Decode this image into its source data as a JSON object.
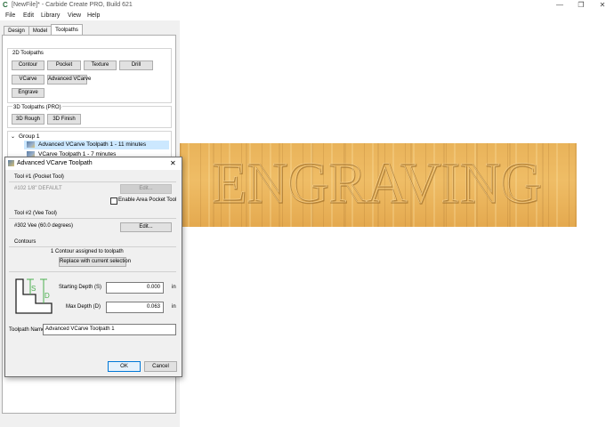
{
  "window": {
    "title": "[NewFile]* - Carbide Create PRO, Build 621",
    "controls": [
      "—",
      "❐",
      "✕"
    ]
  },
  "menu": [
    "File",
    "Edit",
    "Library",
    "View",
    "Help"
  ],
  "tabs": [
    "Design",
    "Model",
    "Toolpaths"
  ],
  "toolpaths_2d": {
    "title": "2D Toolpaths",
    "buttons": [
      "Contour",
      "Pocket",
      "Texture",
      "Drill",
      "VCarve",
      "Advanced VCarve",
      "Engrave"
    ]
  },
  "toolpaths_3d": {
    "title": "3D Toolpaths (PRO)",
    "buttons": [
      "3D Rough",
      "3D Finish"
    ]
  },
  "tree": {
    "group": "Group 1",
    "items": [
      "Advanced VCarve Toolpath 1 - 11 minutes",
      "VCarve Toolpath 1 - 7 minutes"
    ]
  },
  "canvas": {
    "engraved_text": "ENGRAVING",
    "colors": {
      "wood": "#e9b35a",
      "engrave": "#b7863d"
    }
  },
  "dialog": {
    "title": "Advanced VCarve Toolpath",
    "tool1": {
      "title": "Tool #1 (Pocket Tool)",
      "value": "#102 1/8\" DEFAULT",
      "edit": "Edit...",
      "checkbox": "Enable Area Pocket Tool"
    },
    "tool2": {
      "title": "Tool #2 (Vee Tool)",
      "value": "#302 Vee (60.0 degrees)",
      "edit": "Edit..."
    },
    "contours": {
      "title": "Contours",
      "status": "1 Contour assigned to toolpath",
      "replace": "Replace with current selection"
    },
    "diagram": {
      "s": "S",
      "d": "D"
    },
    "depths": {
      "start_label": "Starting Depth (S)",
      "start_value": "0.000",
      "max_label": "Max Depth (D)",
      "max_value": "0.063",
      "unit": "in"
    },
    "name": {
      "label": "Toolpath Name",
      "value": "Advanced VCarve Toolpath 1"
    },
    "ok": "OK",
    "cancel": "Cancel"
  }
}
